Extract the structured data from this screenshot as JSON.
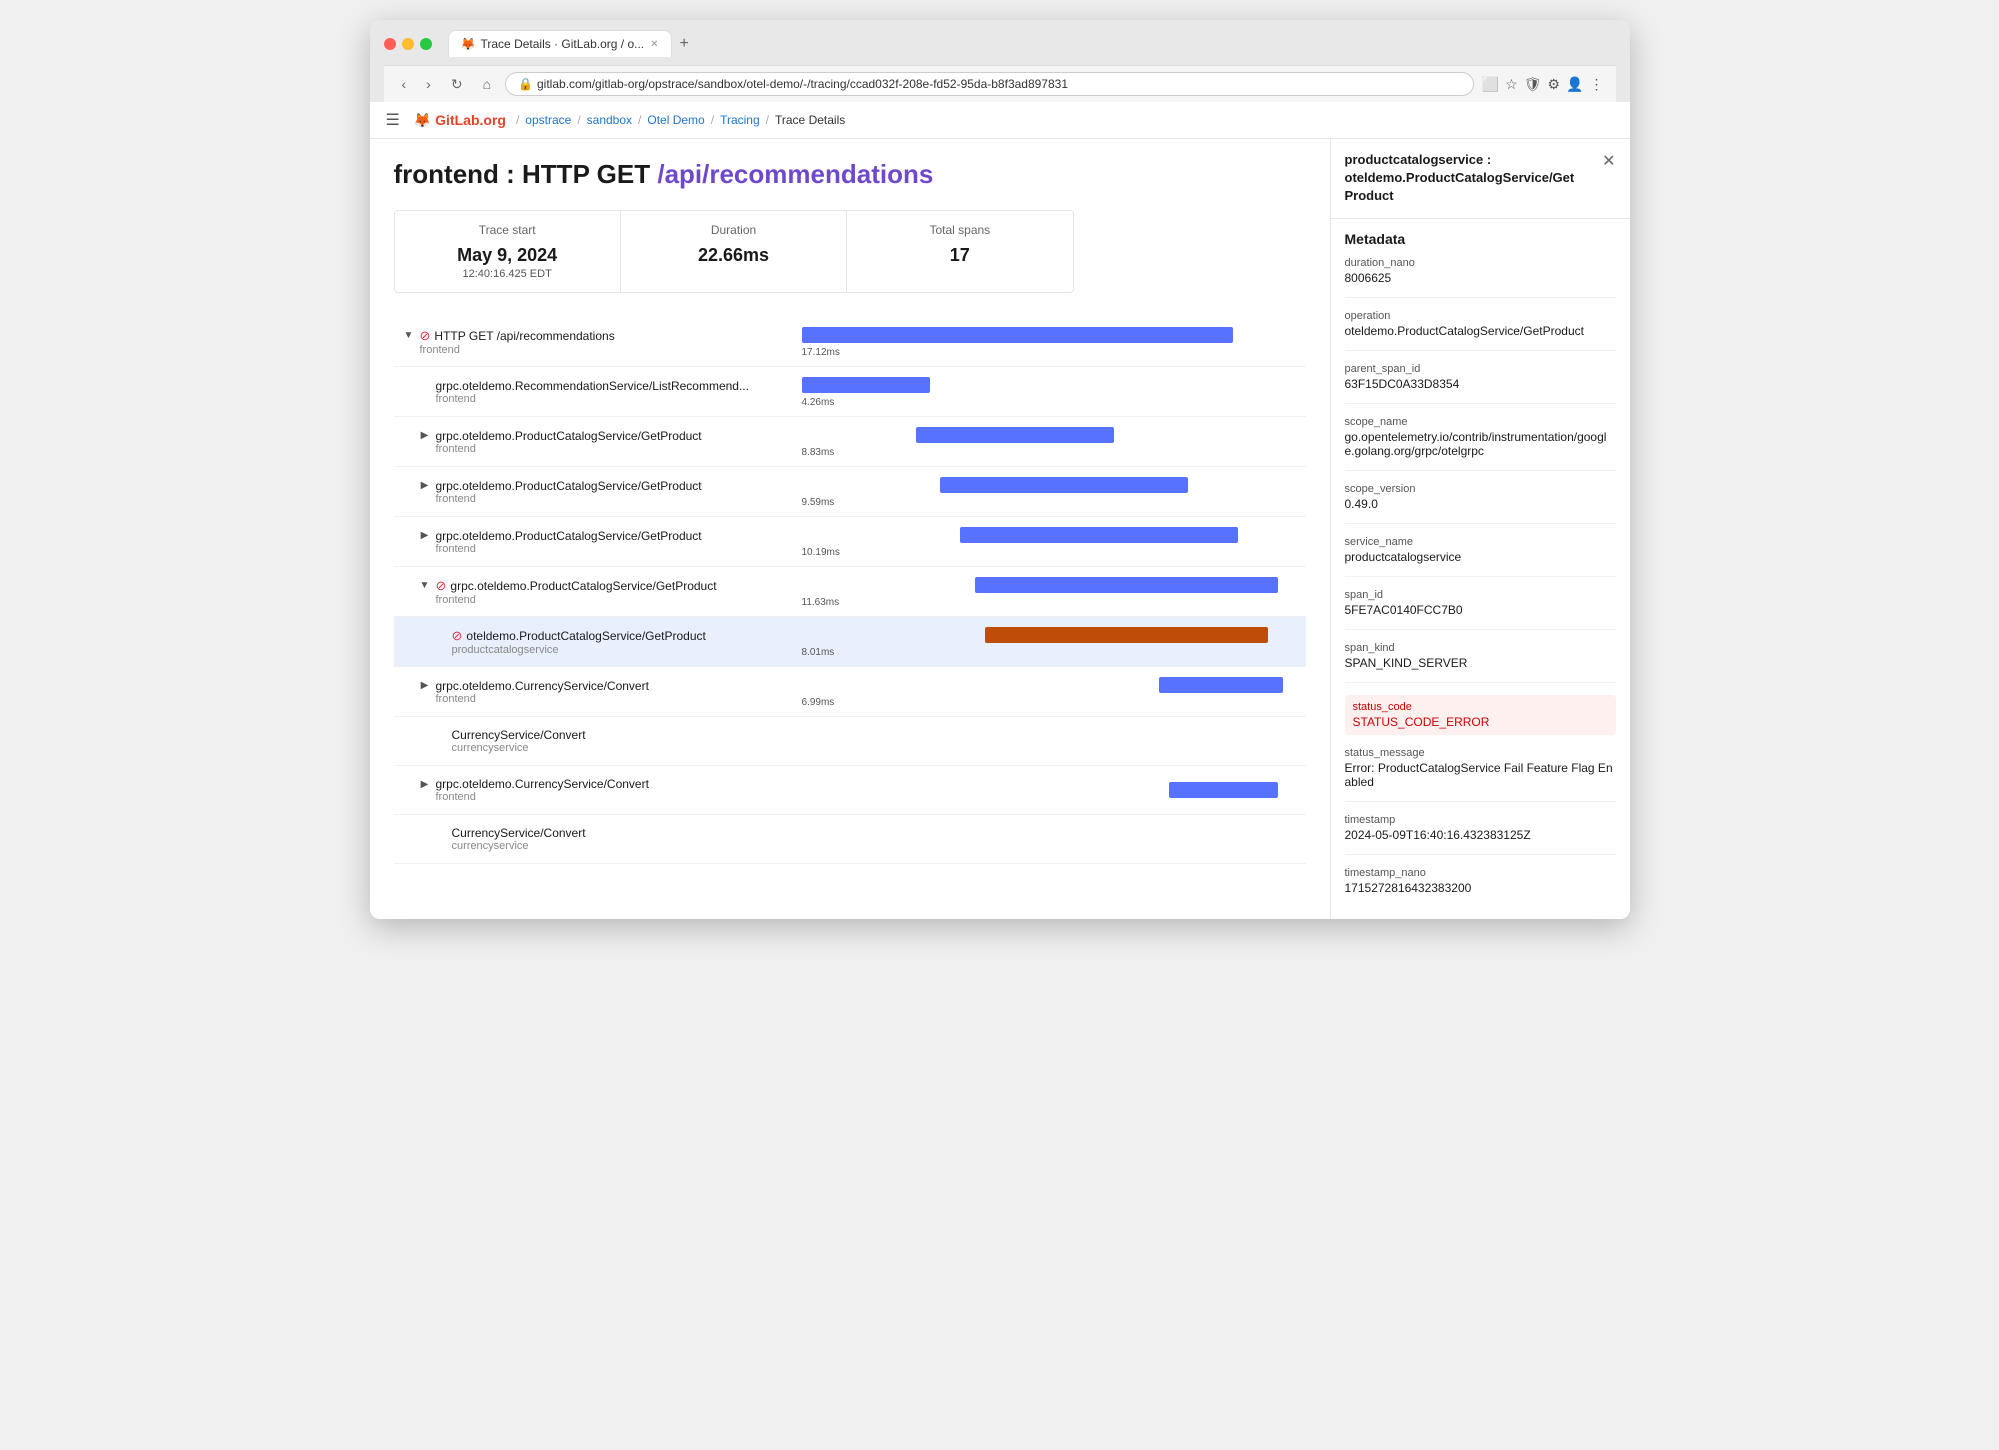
{
  "browser": {
    "tab_title": "Trace Details · GitLab.org / o...",
    "tab_favicon": "🦊",
    "url": "gitlab.com/gitlab-org/opstrace/sandbox/otel-demo/-/tracing/ccad032f-208e-fd52-95da-b8f3ad897831",
    "new_tab_label": "+"
  },
  "breadcrumbs": [
    {
      "label": "GitLab.org",
      "href": "#"
    },
    {
      "label": "opstrace",
      "href": "#"
    },
    {
      "label": "sandbox",
      "href": "#"
    },
    {
      "label": "Otel Demo",
      "href": "#"
    },
    {
      "label": "Tracing",
      "href": "#"
    },
    {
      "label": "Trace Details",
      "current": true
    }
  ],
  "page": {
    "title_prefix": "frontend : HTTP GET ",
    "title_route": "/api/recommendations"
  },
  "stats": {
    "trace_start_label": "Trace start",
    "trace_start_date": "May 9, 2024",
    "trace_start_time": "12:40:16.425 EDT",
    "duration_label": "Duration",
    "duration_value": "22.66ms",
    "total_spans_label": "Total spans",
    "total_spans_value": "17"
  },
  "spans": [
    {
      "id": "s1",
      "indent": 0,
      "expandable": true,
      "expanded": true,
      "error": true,
      "name": "HTTP GET /api/recommendations",
      "service": "frontend",
      "bar_left_pct": 0,
      "bar_width_pct": 87,
      "bar_color": "blue",
      "duration": "17.12ms"
    },
    {
      "id": "s2",
      "indent": 1,
      "expandable": false,
      "expanded": false,
      "error": false,
      "name": "grpc.oteldemo.RecommendationService/ListRecommend...",
      "service": "frontend",
      "bar_left_pct": 0,
      "bar_width_pct": 26,
      "bar_color": "blue",
      "duration": "4.26ms"
    },
    {
      "id": "s3",
      "indent": 1,
      "expandable": true,
      "expanded": false,
      "error": false,
      "name": "grpc.oteldemo.ProductCatalogService/GetProduct",
      "service": "frontend",
      "bar_left_pct": 23,
      "bar_width_pct": 40,
      "bar_color": "blue",
      "duration": "8.83ms"
    },
    {
      "id": "s4",
      "indent": 1,
      "expandable": true,
      "expanded": false,
      "error": false,
      "name": "grpc.oteldemo.ProductCatalogService/GetProduct",
      "service": "frontend",
      "bar_left_pct": 28,
      "bar_width_pct": 50,
      "bar_color": "blue",
      "duration": "9.59ms"
    },
    {
      "id": "s5",
      "indent": 1,
      "expandable": true,
      "expanded": false,
      "error": false,
      "name": "grpc.oteldemo.ProductCatalogService/GetProduct",
      "service": "frontend",
      "bar_left_pct": 32,
      "bar_width_pct": 56,
      "bar_color": "blue",
      "duration": "10.19ms"
    },
    {
      "id": "s6",
      "indent": 1,
      "expandable": true,
      "expanded": true,
      "error": true,
      "name": "grpc.oteldemo.ProductCatalogService/GetProduct",
      "service": "frontend",
      "bar_left_pct": 35,
      "bar_width_pct": 61,
      "bar_color": "blue",
      "duration": "11.63ms"
    },
    {
      "id": "s7",
      "indent": 2,
      "expandable": false,
      "expanded": false,
      "error": true,
      "name": "oteldemo.ProductCatalogService/GetProduct",
      "service": "productcatalogservice",
      "bar_left_pct": 37,
      "bar_width_pct": 57,
      "bar_color": "orange",
      "duration": "8.01ms",
      "selected": true
    },
    {
      "id": "s8",
      "indent": 1,
      "expandable": true,
      "expanded": false,
      "error": false,
      "name": "grpc.oteldemo.CurrencyService/Convert",
      "service": "frontend",
      "bar_left_pct": 72,
      "bar_width_pct": 25,
      "bar_color": "blue",
      "duration": "6.99ms"
    },
    {
      "id": "s9",
      "indent": 2,
      "expandable": false,
      "expanded": false,
      "error": false,
      "name": "CurrencyService/Convert",
      "service": "currencyservice",
      "bar_left_pct": 0,
      "bar_width_pct": 0,
      "bar_color": "blue",
      "duration": ""
    },
    {
      "id": "s10",
      "indent": 1,
      "expandable": true,
      "expanded": false,
      "error": false,
      "name": "grpc.oteldemo.CurrencyService/Convert",
      "service": "frontend",
      "bar_left_pct": 74,
      "bar_width_pct": 22,
      "bar_color": "blue",
      "duration": ""
    },
    {
      "id": "s11",
      "indent": 2,
      "expandable": false,
      "expanded": false,
      "error": false,
      "name": "CurrencyService/Convert",
      "service": "currencyservice",
      "bar_left_pct": 0,
      "bar_width_pct": 0,
      "bar_color": "blue",
      "duration": ""
    }
  ],
  "right_panel": {
    "title": "productcatalogservice : oteldemo.ProductCatalogService/Get Product",
    "metadata_heading": "Metadata",
    "fields": [
      {
        "key": "duration_nano",
        "value": "8006625",
        "error": false
      },
      {
        "key": "operation",
        "value": "oteldemo.ProductCatalogService/GetProduct",
        "error": false
      },
      {
        "key": "parent_span_id",
        "value": "63F15DC0A33D8354",
        "error": false
      },
      {
        "key": "scope_name",
        "value": "go.opentelemetry.io/contrib/instrumentation/google.golang.org/grpc/otelgrpc",
        "error": false
      },
      {
        "key": "scope_version",
        "value": "0.49.0",
        "error": false
      },
      {
        "key": "service_name",
        "value": "productcatalogservice",
        "error": false
      },
      {
        "key": "span_id",
        "value": "5FE7AC0140FCC7B0",
        "error": false
      },
      {
        "key": "span_kind",
        "value": "SPAN_KIND_SERVER",
        "error": false
      },
      {
        "key": "status_code",
        "value": "STATUS_CODE_ERROR",
        "error": true
      },
      {
        "key": "status_message",
        "value": "Error: ProductCatalogService Fail Feature Flag Enabled",
        "error": false
      },
      {
        "key": "timestamp",
        "value": "2024-05-09T16:40:16.432383125Z",
        "error": false
      },
      {
        "key": "timestamp_nano",
        "value": "1715272816432383200",
        "error": false
      }
    ]
  }
}
